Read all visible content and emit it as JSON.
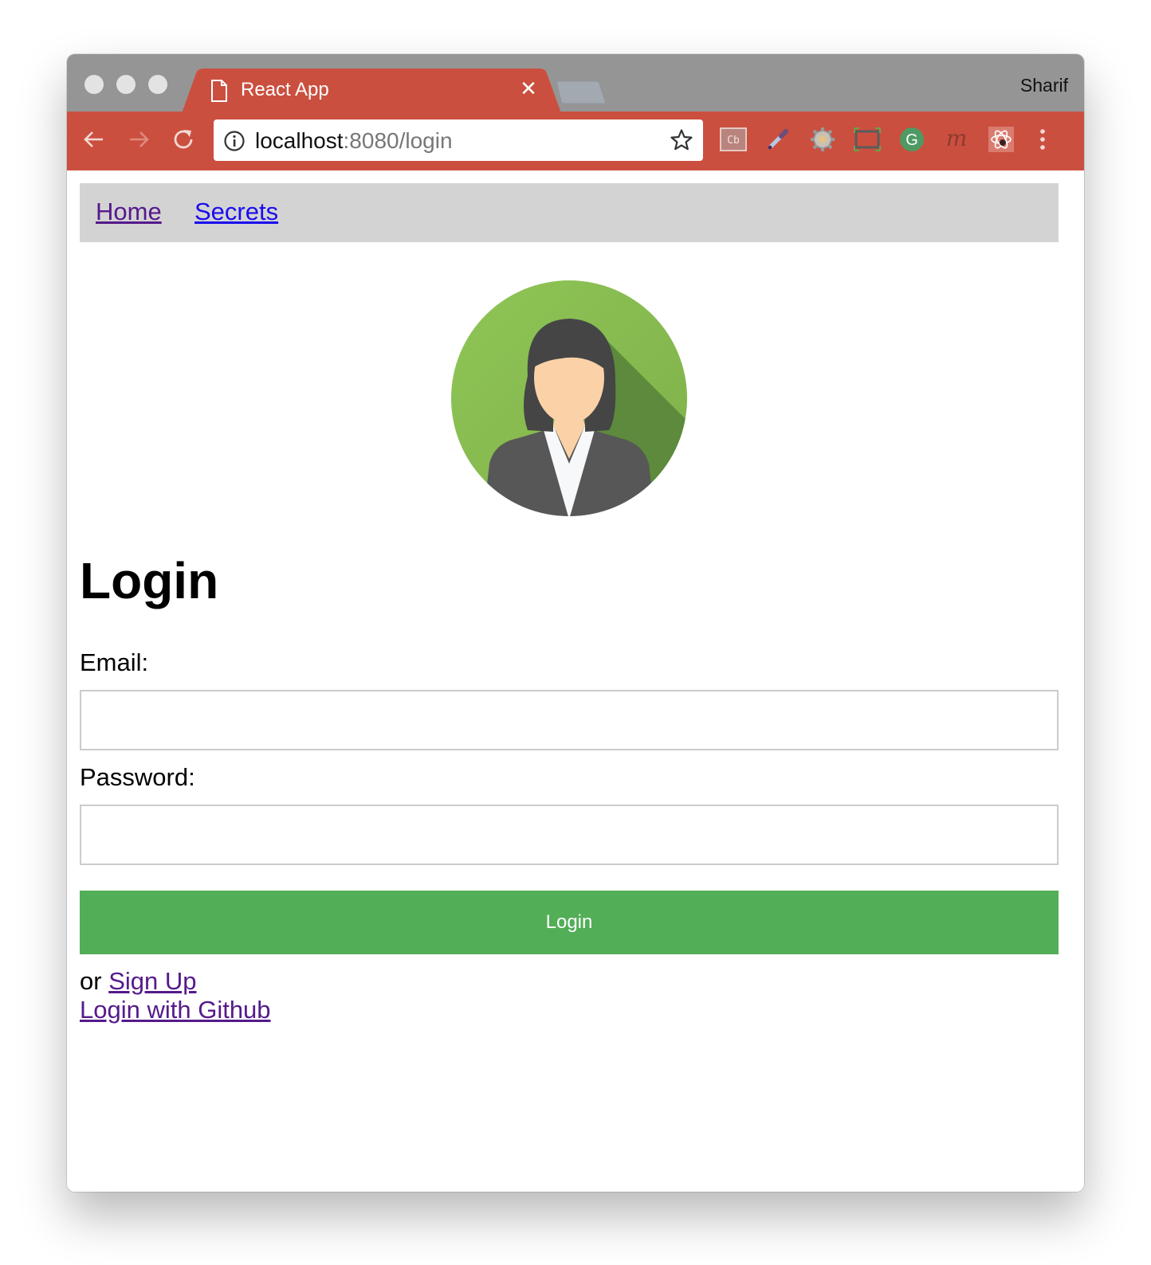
{
  "browser": {
    "tab_title": "React App",
    "profile_name": "Sharif",
    "url_host": "localhost",
    "url_rest": ":8080/login",
    "theme_color": "#cb4f3f",
    "extensions": [
      {
        "icon": "cb-icon",
        "glyph": "Cb"
      },
      {
        "icon": "eyedropper-icon"
      },
      {
        "icon": "gear-icon"
      },
      {
        "icon": "window-resizer-icon"
      },
      {
        "icon": "grammarly-icon",
        "glyph": "G"
      },
      {
        "icon": "m-icon",
        "glyph": "m"
      },
      {
        "icon": "react-devtools-icon"
      }
    ]
  },
  "nav": {
    "home": "Home",
    "secrets": "Secrets"
  },
  "page": {
    "heading": "Login",
    "email_label": "Email:",
    "email_value": "",
    "password_label": "Password:",
    "password_value": "",
    "login_button": "Login",
    "or_text": "or ",
    "signup_link": "Sign Up",
    "github_link": "Login with Github",
    "accent_color": "#52ae57"
  }
}
